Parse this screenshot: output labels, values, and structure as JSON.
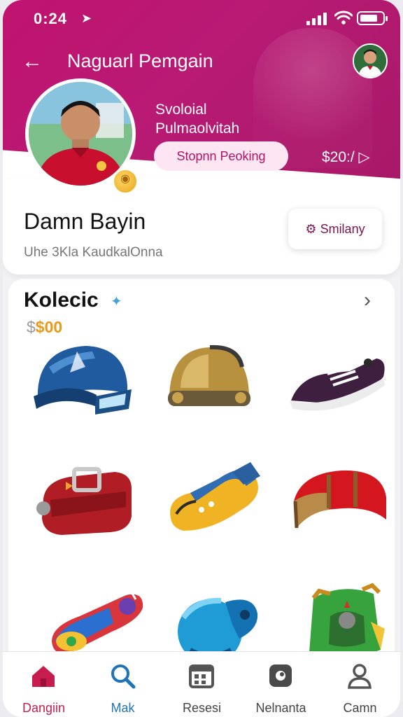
{
  "status_bar": {
    "time": "0:24"
  },
  "header": {
    "title": "Naguarl Pemgain",
    "subtitle_line1": "Svoloial",
    "subtitle_line2": "Pulmaolvitah",
    "pill_label": "Stopnn Peoking",
    "price": "$20:/"
  },
  "profile": {
    "name": "Damn Bayin",
    "sub": "Uhe 3Kla KaudkalOnna",
    "action_label": "Smilany"
  },
  "collection": {
    "title": "Kolecic",
    "price_prefix": "$",
    "price_value": "$00",
    "items": [
      "blue-helmet",
      "gold-helmet",
      "purple-sneaker",
      "red-bag",
      "yellow-blue-shoe",
      "red-saddle",
      "rainbow-skate",
      "blue-ball-shoe",
      "green-backpack"
    ]
  },
  "tabs": [
    {
      "label": "Dangiin",
      "icon": "home-icon",
      "active": true
    },
    {
      "label": "Mak",
      "icon": "search-icon",
      "active": false
    },
    {
      "label": "Resesi",
      "icon": "calendar-icon",
      "active": false
    },
    {
      "label": "Nelnanta",
      "icon": "chat-icon",
      "active": false
    },
    {
      "label": "Camn",
      "icon": "profile-icon",
      "active": false
    }
  ],
  "colors": {
    "brand": "#c0136f",
    "active_tab": "#c61c4e",
    "price": "#e89a1a"
  }
}
